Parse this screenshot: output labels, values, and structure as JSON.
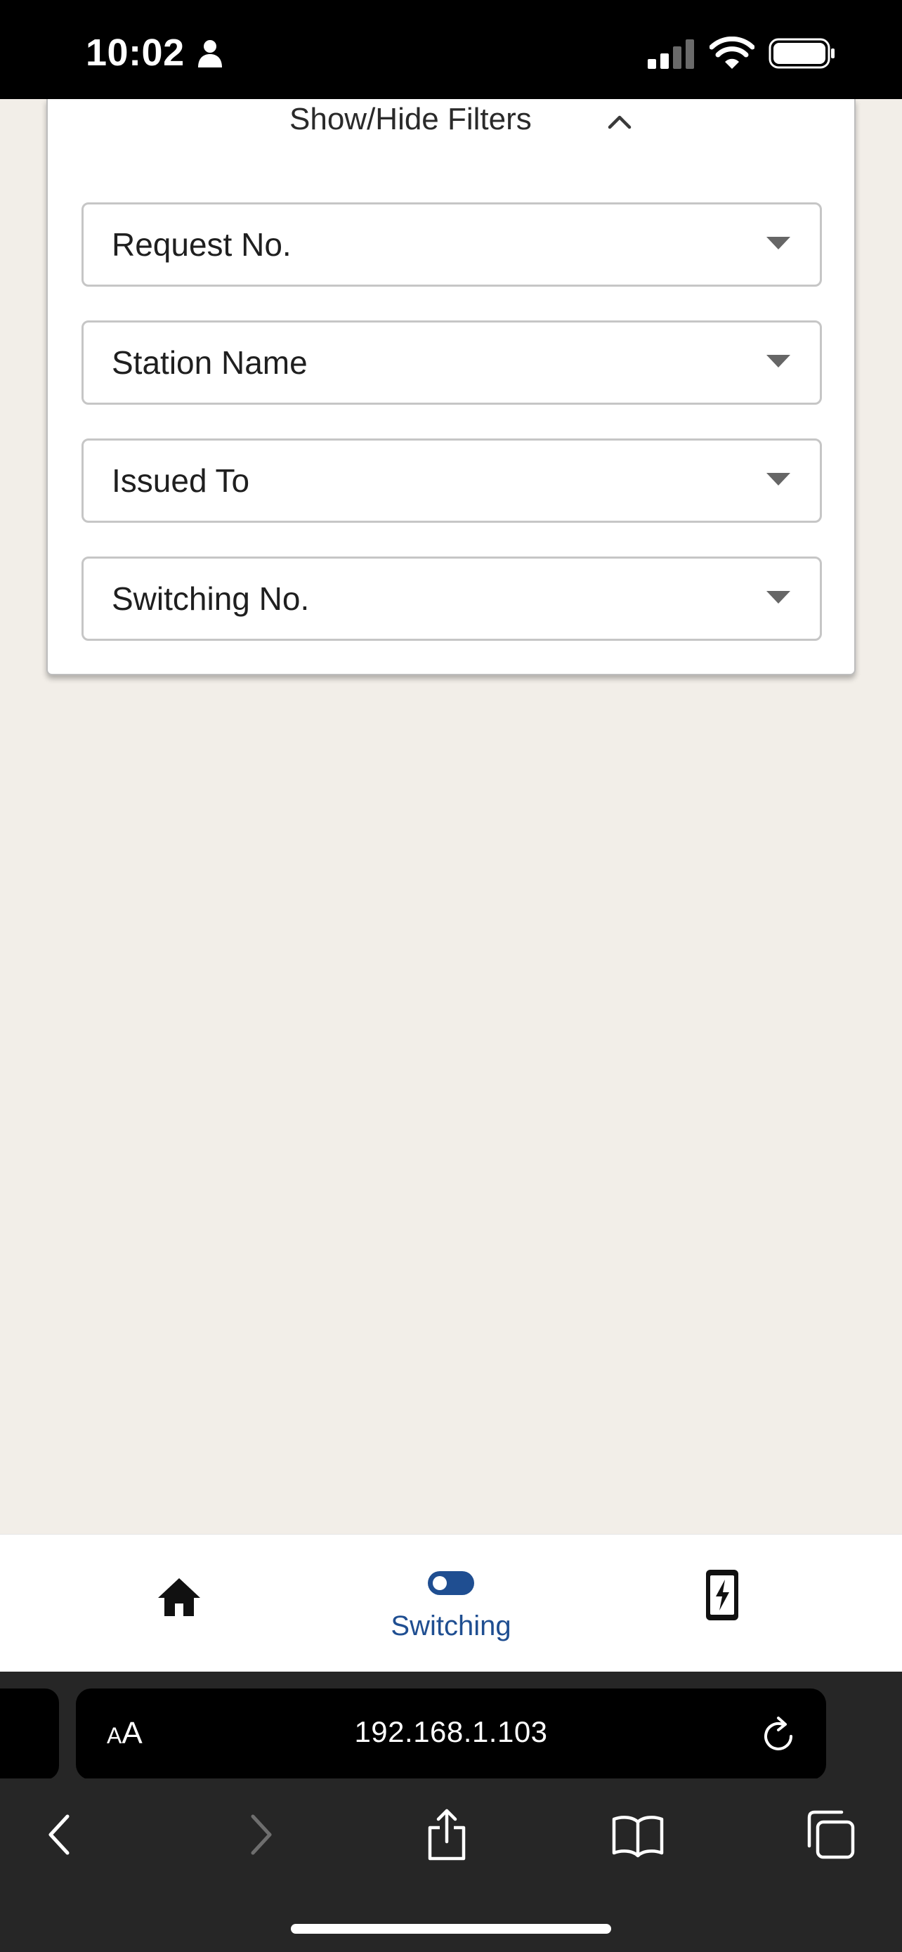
{
  "status_bar": {
    "time": "10:02",
    "icons": [
      "person-icon",
      "cellular-signal-icon",
      "wifi-icon",
      "battery-icon"
    ]
  },
  "filters": {
    "toggle_label": "Show/Hide Filters",
    "toggle_icon": "chevron-up-icon",
    "fields": [
      {
        "label": "Request No.",
        "icon": "caret-down-icon"
      },
      {
        "label": "Station Name",
        "icon": "caret-down-icon"
      },
      {
        "label": "Issued To",
        "icon": "caret-down-icon"
      },
      {
        "label": "Switching No.",
        "icon": "caret-down-icon"
      }
    ]
  },
  "app_nav": {
    "items": [
      {
        "icon": "home-icon",
        "label": ""
      },
      {
        "icon": "toggle-switch-icon",
        "label": "Switching",
        "active": true
      },
      {
        "icon": "charging-device-icon",
        "label": ""
      }
    ],
    "active_color": "#1f4e91"
  },
  "browser": {
    "text_size_button": {
      "small": "A",
      "large": "A"
    },
    "url": "192.168.1.103",
    "icons": [
      "reload-icon",
      "back-icon",
      "forward-icon",
      "share-icon",
      "bookmarks-icon",
      "tabs-icon"
    ]
  },
  "colors": {
    "background": "#f2eee8",
    "card": "#ffffff",
    "browser_chrome": "#262626",
    "accent": "#1f4e91"
  }
}
